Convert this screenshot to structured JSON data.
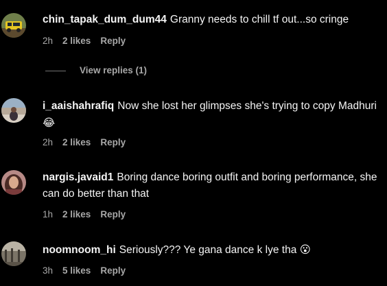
{
  "comments": [
    {
      "username": "chin_tapak_dum_dum44",
      "text": "Granny needs to chill tf out...so cringe",
      "time": "2h",
      "likes": "2 likes",
      "reply": "Reply",
      "view_replies": "View replies (1)"
    },
    {
      "username": "i_aaishahrafiq",
      "text": "Now she lost her glimpses she's trying to copy Madhuri",
      "emoji": "😂",
      "time": "2h",
      "likes": "2 likes",
      "reply": "Reply"
    },
    {
      "username": "nargis.javaid1",
      "text": "Boring dance boring outfit and boring performance, she can do better than that",
      "time": "1h",
      "likes": "2 likes",
      "reply": "Reply"
    },
    {
      "username": "noomnoom_hi",
      "text": "Seriously??? Ye gana dance k lye tha",
      "emoji": "😮",
      "time": "3h",
      "likes": "5 likes",
      "reply": "Reply"
    }
  ]
}
